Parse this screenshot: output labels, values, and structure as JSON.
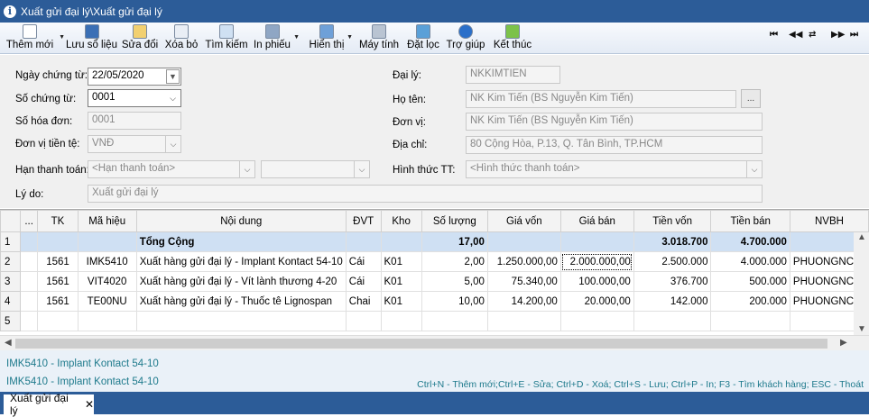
{
  "window": {
    "title": "Xuất gửi đại lý\\Xuất gửi đại lý",
    "info_glyph": "i"
  },
  "toolbar": [
    {
      "label": "Thêm mới",
      "icon": "new-document-icon",
      "dropdown": true
    },
    {
      "label": "Lưu sổ liệu",
      "icon": "save-icon"
    },
    {
      "label": "Sửa đổi",
      "icon": "edit-icon"
    },
    {
      "label": "Xóa bỏ",
      "icon": "delete-icon"
    },
    {
      "label": "Tìm kiếm",
      "icon": "search-icon"
    },
    {
      "label": "In phiếu",
      "icon": "print-icon",
      "dropdown": true
    },
    {
      "label": "Hiển thị",
      "icon": "display-icon",
      "dropdown": true
    },
    {
      "label": "Máy tính",
      "icon": "calculator-icon"
    },
    {
      "label": "Đặt lọc",
      "icon": "filter-icon"
    },
    {
      "label": "Trợ giúp",
      "icon": "help-icon"
    },
    {
      "label": "Kết thúc",
      "icon": "exit-icon"
    }
  ],
  "nav": {
    "first": "⏮",
    "prev": "◀◀",
    "refresh": "⇄",
    "next": "▶▶",
    "last": "⏭"
  },
  "form": {
    "ngay_ct": {
      "label": "Ngày chứng từ:",
      "value": "22/05/2020"
    },
    "so_ct": {
      "label": "Số chứng từ:",
      "value": "0001"
    },
    "so_hd": {
      "label": "Số hóa đơn:",
      "value": "0001"
    },
    "tien_te": {
      "label": "Đơn vị tiền tệ:",
      "value": "VNĐ"
    },
    "han_tt": {
      "label": "Hạn thanh toán:",
      "value": "<Hạn thanh toán>",
      "value2": ""
    },
    "ly_do": {
      "label": "Lý do:",
      "value": "Xuất gửi đại lý"
    },
    "dai_ly": {
      "label": "Đại lý:",
      "value": "NKKIMTIEN"
    },
    "ho_ten": {
      "label": "Họ tên:",
      "value": "NK Kim Tiến (BS Nguyễn Kim Tiến)",
      "button": "..."
    },
    "don_vi": {
      "label": "Đơn vị:",
      "value": "NK Kim Tiến (BS Nguyễn Kim Tiến)"
    },
    "dia_chi": {
      "label": "Địa chỉ:",
      "value": "80 Cộng Hòa, P.13, Q. Tân Bình, TP.HCM"
    },
    "hinh_thuc": {
      "label": "Hình thức TT:",
      "value": "<Hình thức thanh toán>"
    }
  },
  "grid": {
    "headers": [
      "",
      "...",
      "TK",
      "Mã hiệu",
      "Nội dung",
      "ĐVT",
      "Kho",
      "Số lượng",
      "Giá vốn",
      "Giá bán",
      "Tiền vốn",
      "Tiền bán",
      "NVBH"
    ],
    "rows": [
      [
        "1",
        "",
        "",
        "",
        "Tổng Cộng",
        "",
        "",
        "17,00",
        "",
        "",
        "3.018.700",
        "4.700.000",
        ""
      ],
      [
        "2",
        "",
        "1561",
        "IMK5410",
        "Xuất hàng gửi đại lý - Implant Kontact 54-10",
        "Cái",
        "K01",
        "2,00",
        "1.250.000,00",
        "2.000.000,00",
        "2.500.000",
        "4.000.000",
        "PHUONGNC"
      ],
      [
        "3",
        "",
        "1561",
        "VIT4020",
        "Xuất hàng gửi đại lý - Vít lành thương 4-20",
        "Cái",
        "K01",
        "5,00",
        "75.340,00",
        "100.000,00",
        "376.700",
        "500.000",
        "PHUONGNC"
      ],
      [
        "4",
        "",
        "1561",
        "TE00NU",
        "Xuất hàng gửi đại lý - Thuốc tê Lignospan",
        "Chai",
        "K01",
        "10,00",
        "14.200,00",
        "20.000,00",
        "142.000",
        "200.000",
        "PHUONGNC"
      ],
      [
        "5",
        "",
        "",
        "",
        "",
        "",
        "",
        "",
        "",
        "",
        "",
        "",
        ""
      ]
    ]
  },
  "status": {
    "line1": "IMK5410 - Implant Kontact 54-10",
    "line2": "IMK5410 - Implant Kontact 54-10",
    "shortcuts": "Ctrl+N - Thêm mới;Ctrl+E - Sửa; Ctrl+D - Xoá; Ctrl+S - Lưu; Ctrl+P - In; F3 - Tìm khách hàng; ESC - Thoát"
  },
  "tab": {
    "label": "Xuất gửi đại lý",
    "close": "✕"
  }
}
